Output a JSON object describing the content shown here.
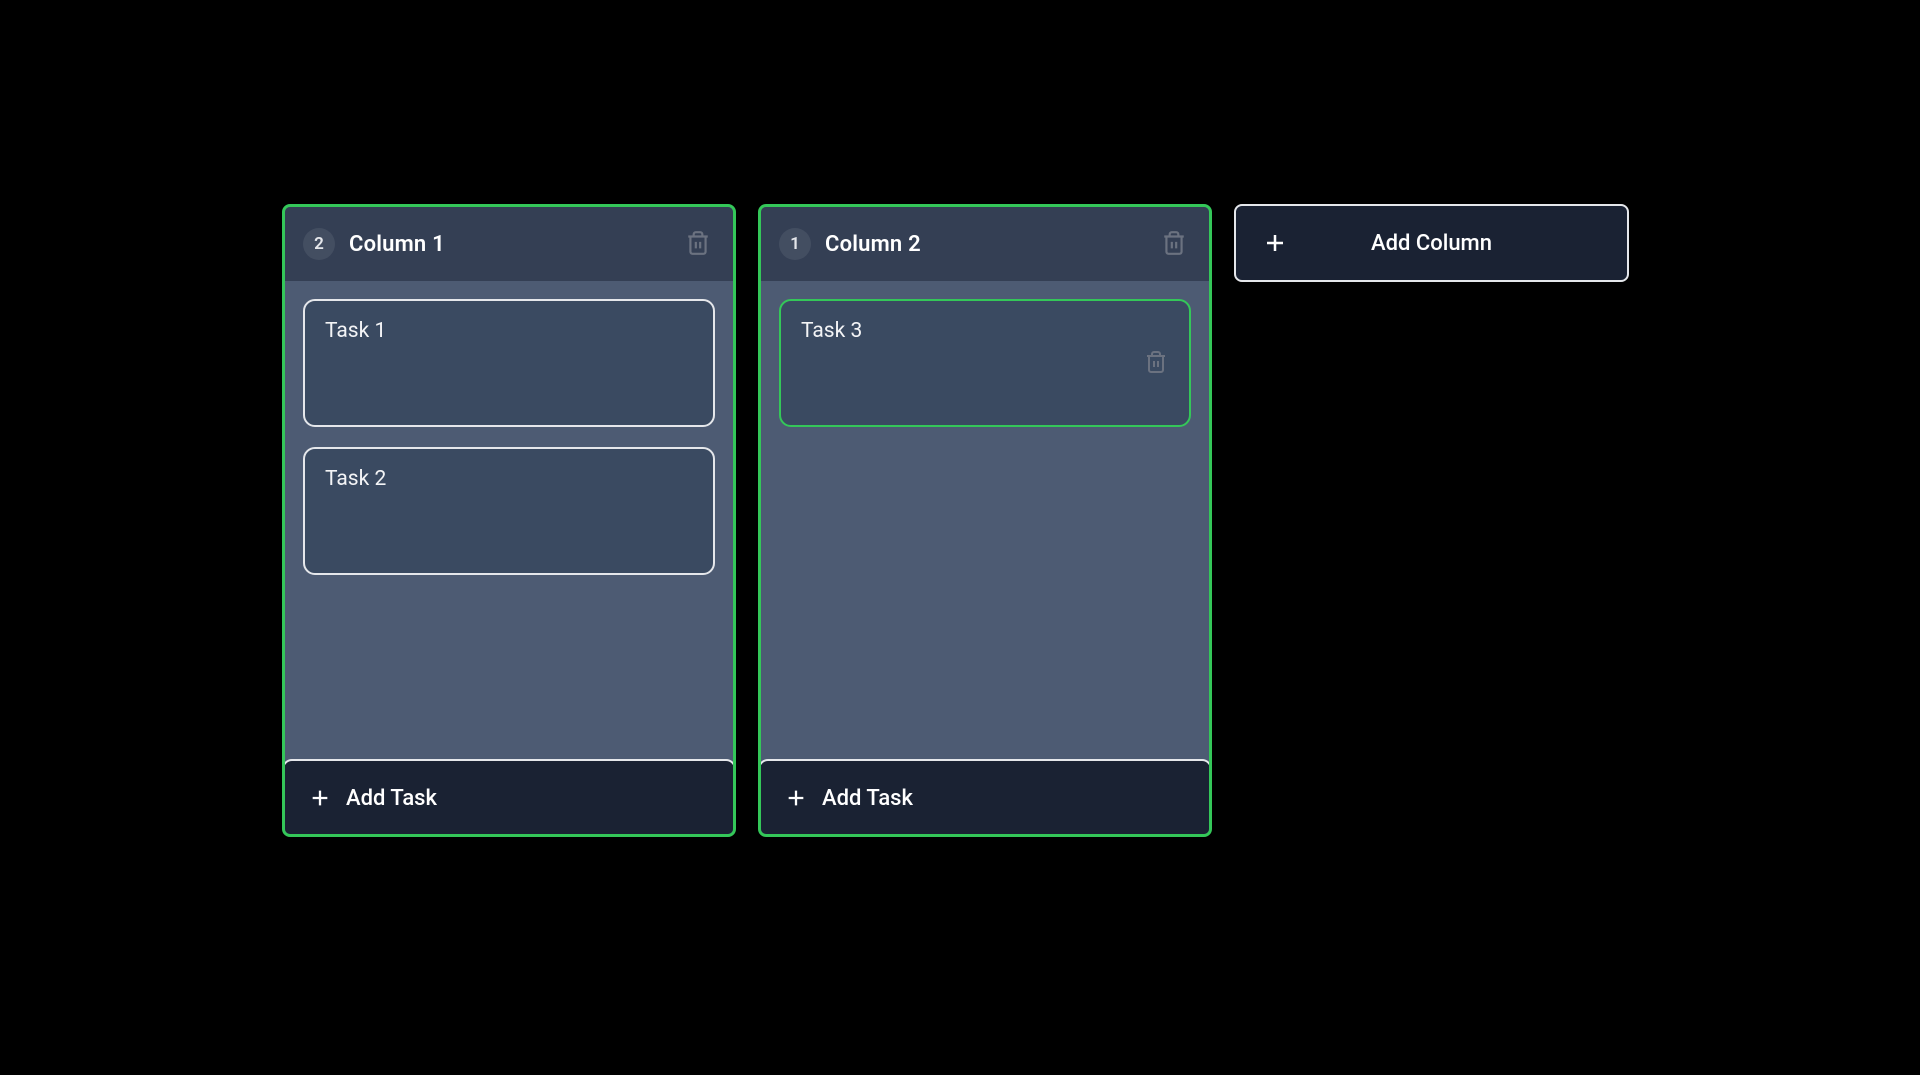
{
  "board": {
    "add_column_label": "Add Column",
    "columns": [
      {
        "count": "2",
        "title": "Column 1",
        "add_task_label": "Add Task",
        "cards": [
          {
            "title": "Task 1",
            "highlighted": false,
            "show_trash": false
          },
          {
            "title": "Task 2",
            "highlighted": false,
            "show_trash": false
          }
        ]
      },
      {
        "count": "1",
        "title": "Column 2",
        "add_task_label": "Add Task",
        "cards": [
          {
            "title": "Task 3",
            "highlighted": true,
            "show_trash": true
          }
        ]
      }
    ]
  }
}
